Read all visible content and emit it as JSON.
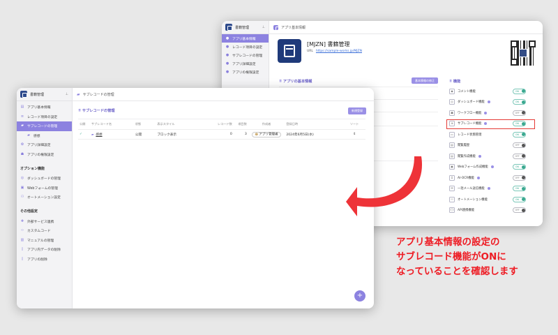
{
  "back_window": {
    "brand": "書籍管理",
    "breadcrumb": "アプリ基本情報",
    "sidebar": [
      {
        "label": "アプリ基本情報",
        "active": true
      },
      {
        "label": "レコード項目の設定",
        "active": false
      },
      {
        "label": "サブレコードの管理",
        "active": false
      },
      {
        "label": "アプリ詳細設定",
        "active": false
      },
      {
        "label": "アプリの権限設定",
        "active": false
      }
    ],
    "app_name": "[MJZN] 書籍管理",
    "url_label": "URL",
    "url_value": "https://sample-works.jp/MJZN",
    "info_heading": "アプリの基本情報",
    "edit_button": "基本情報の修正",
    "features_heading": "機能",
    "features": [
      {
        "label": "コメント機能",
        "state": "ON",
        "help": false,
        "icon": "comment"
      },
      {
        "label": "ダッシュボード機能",
        "state": "ON",
        "help": true,
        "icon": "dashboard"
      },
      {
        "label": "ワークフロー機能",
        "state": "OFF",
        "help": true,
        "icon": "workflow"
      },
      {
        "label": "サブレコード機能",
        "state": "ON",
        "help": true,
        "icon": "subrecord"
      },
      {
        "label": "レコード状態管理",
        "state": "ON",
        "help": false,
        "icon": "status"
      },
      {
        "label": "閲覧履歴",
        "state": "OFF",
        "help": false,
        "icon": "history"
      },
      {
        "label": "閲覧作成機能",
        "state": "OFF",
        "help": true,
        "icon": "create"
      },
      {
        "label": "Webフォーム作成機能",
        "state": "ON",
        "help": true,
        "icon": "webform"
      },
      {
        "label": "AI-OCR機能",
        "state": "OFF",
        "help": true,
        "icon": "ocr"
      },
      {
        "label": "一括メール送信機能",
        "state": "ON",
        "help": true,
        "icon": "mail"
      },
      {
        "label": "オートメーション機能",
        "state": "ON",
        "help": false,
        "icon": "automation"
      },
      {
        "label": "API連携機能",
        "state": "OFF",
        "help": false,
        "icon": "api"
      }
    ]
  },
  "front_window": {
    "brand": "書籍管理",
    "breadcrumb": "サブレコードの管理",
    "sidebar_top": [
      {
        "label": "アプリ基本情報",
        "icon": "doc",
        "active": false,
        "sub": false
      },
      {
        "label": "レコード項目の設定",
        "icon": "list",
        "active": false,
        "sub": false
      },
      {
        "label": "サブレコードの管理",
        "icon": "folder",
        "active": true,
        "sub": false
      },
      {
        "label": "感想",
        "icon": "folder",
        "active": false,
        "sub": true
      },
      {
        "label": "アプリ詳細設定",
        "icon": "gear",
        "active": false,
        "sub": false
      },
      {
        "label": "アプリの権限設定",
        "icon": "users",
        "active": false,
        "sub": false
      }
    ],
    "section_options": "オプション機能",
    "sidebar_options": [
      {
        "label": "ダッシュボードの管理",
        "icon": "dashboard"
      },
      {
        "label": "Webフォームの管理",
        "icon": "webform"
      },
      {
        "label": "オートメーション設定",
        "icon": "automation"
      }
    ],
    "section_other": "その他設定",
    "sidebar_other": [
      {
        "label": "外部サービス連携",
        "icon": "puzzle"
      },
      {
        "label": "カスタムコード",
        "icon": "code"
      },
      {
        "label": "マニュアルの管理",
        "icon": "book"
      },
      {
        "label": "アプリ内データの削除",
        "icon": "trash"
      },
      {
        "label": "アプリの削除",
        "icon": "trash"
      }
    ],
    "heading": "サブレコードの管理",
    "new_button": "新規登録",
    "columns": [
      "公開",
      "サブレコード名",
      "状態",
      "表示スタイル",
      "レコード数",
      "項目数",
      "作成者",
      "登録日時",
      "ソート"
    ],
    "rows": [
      {
        "public": "✓",
        "name": "感想",
        "status": "公開",
        "style": "ブロック表示",
        "records": "0",
        "fields": "3",
        "author": "アプリ管理者",
        "date": "2024年6月5日(水)",
        "sort": "⇕"
      }
    ],
    "fab": "+"
  },
  "annotation": {
    "line1": "アプリ基本情報の設定の",
    "line2": "サブレコード機能がONに",
    "line3": "なっていることを確認します"
  },
  "colors": {
    "accent": "#8c82e0",
    "highlight": "#e53935",
    "arrow": "#ee3338",
    "toggle_on": "#3aa88f"
  }
}
